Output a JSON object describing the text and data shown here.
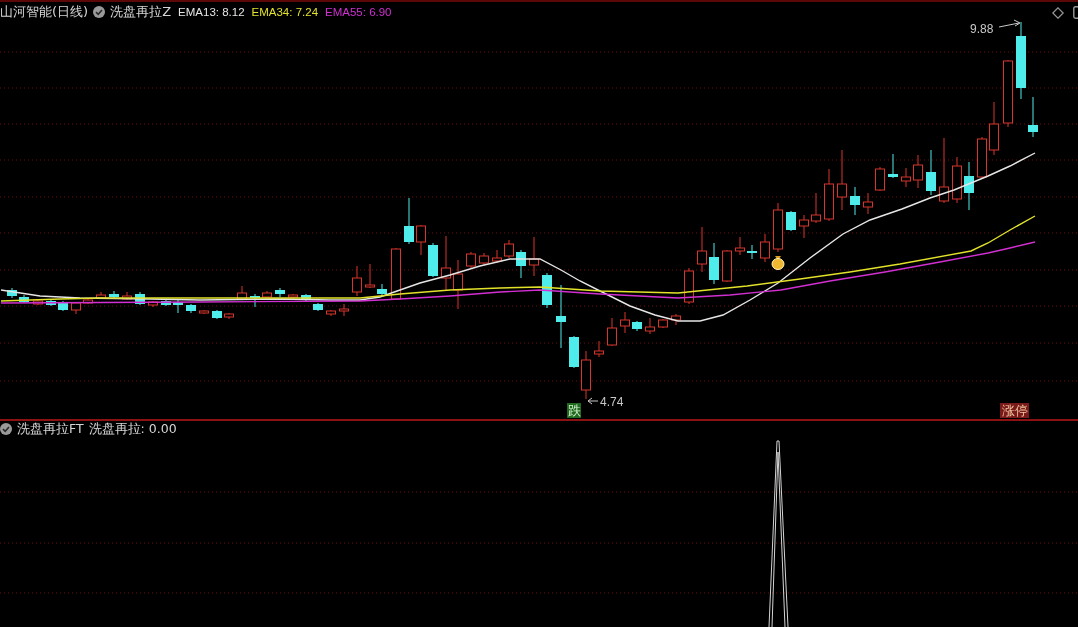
{
  "main_panel": {
    "stock_title": "山河智能(日线)",
    "indicator_name": "洗盘再拉Z",
    "readings": [
      {
        "label": "EMA13: 8.12",
        "color": "#e6e6e6"
      },
      {
        "label": "EMA34: 7.24",
        "color": "#e2e22a"
      },
      {
        "label": "EMA55: 6.90",
        "color": "#d12fd1"
      }
    ],
    "high_label": "9.88",
    "low_label": "4.74",
    "signals": [
      {
        "text": "跌",
        "kind": "fall"
      },
      {
        "text": "涨停",
        "kind": "limit_up"
      }
    ]
  },
  "sub_panel": {
    "indicator_name": "洗盘再拉FT",
    "reading": "洗盘再拉: 0.00"
  }
}
